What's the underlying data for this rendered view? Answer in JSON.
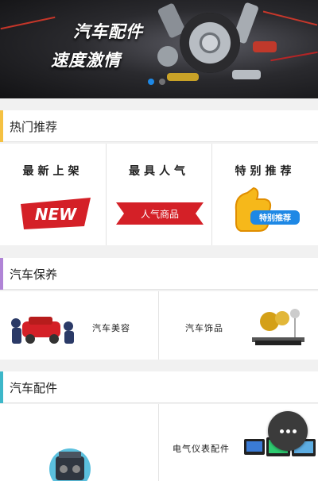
{
  "banner": {
    "title_line1": "汽车配件",
    "title_line2": "速度激情",
    "active_slide": 1,
    "slide_count": 2
  },
  "sections": {
    "hot": {
      "title": "热门推荐",
      "accent": "#f5c142"
    },
    "maintenance": {
      "title": "汽车保养",
      "accent": "#b084d6"
    },
    "parts": {
      "title": "汽车配件",
      "accent": "#3db7c9"
    }
  },
  "hot_items": [
    {
      "label": "最新上架",
      "badge": "NEW"
    },
    {
      "label": "最具人气",
      "badge": "人气商品"
    },
    {
      "label": "特别推荐",
      "badge": "特别推荐"
    }
  ],
  "maintenance_items": [
    {
      "label": "汽车美容"
    },
    {
      "label": "汽车饰品"
    }
  ],
  "parts_items": [
    {
      "label": ""
    },
    {
      "label": "电气仪表配件"
    }
  ],
  "colors": {
    "accent_blue": "#1e88e5",
    "badge_red": "#d42027"
  }
}
